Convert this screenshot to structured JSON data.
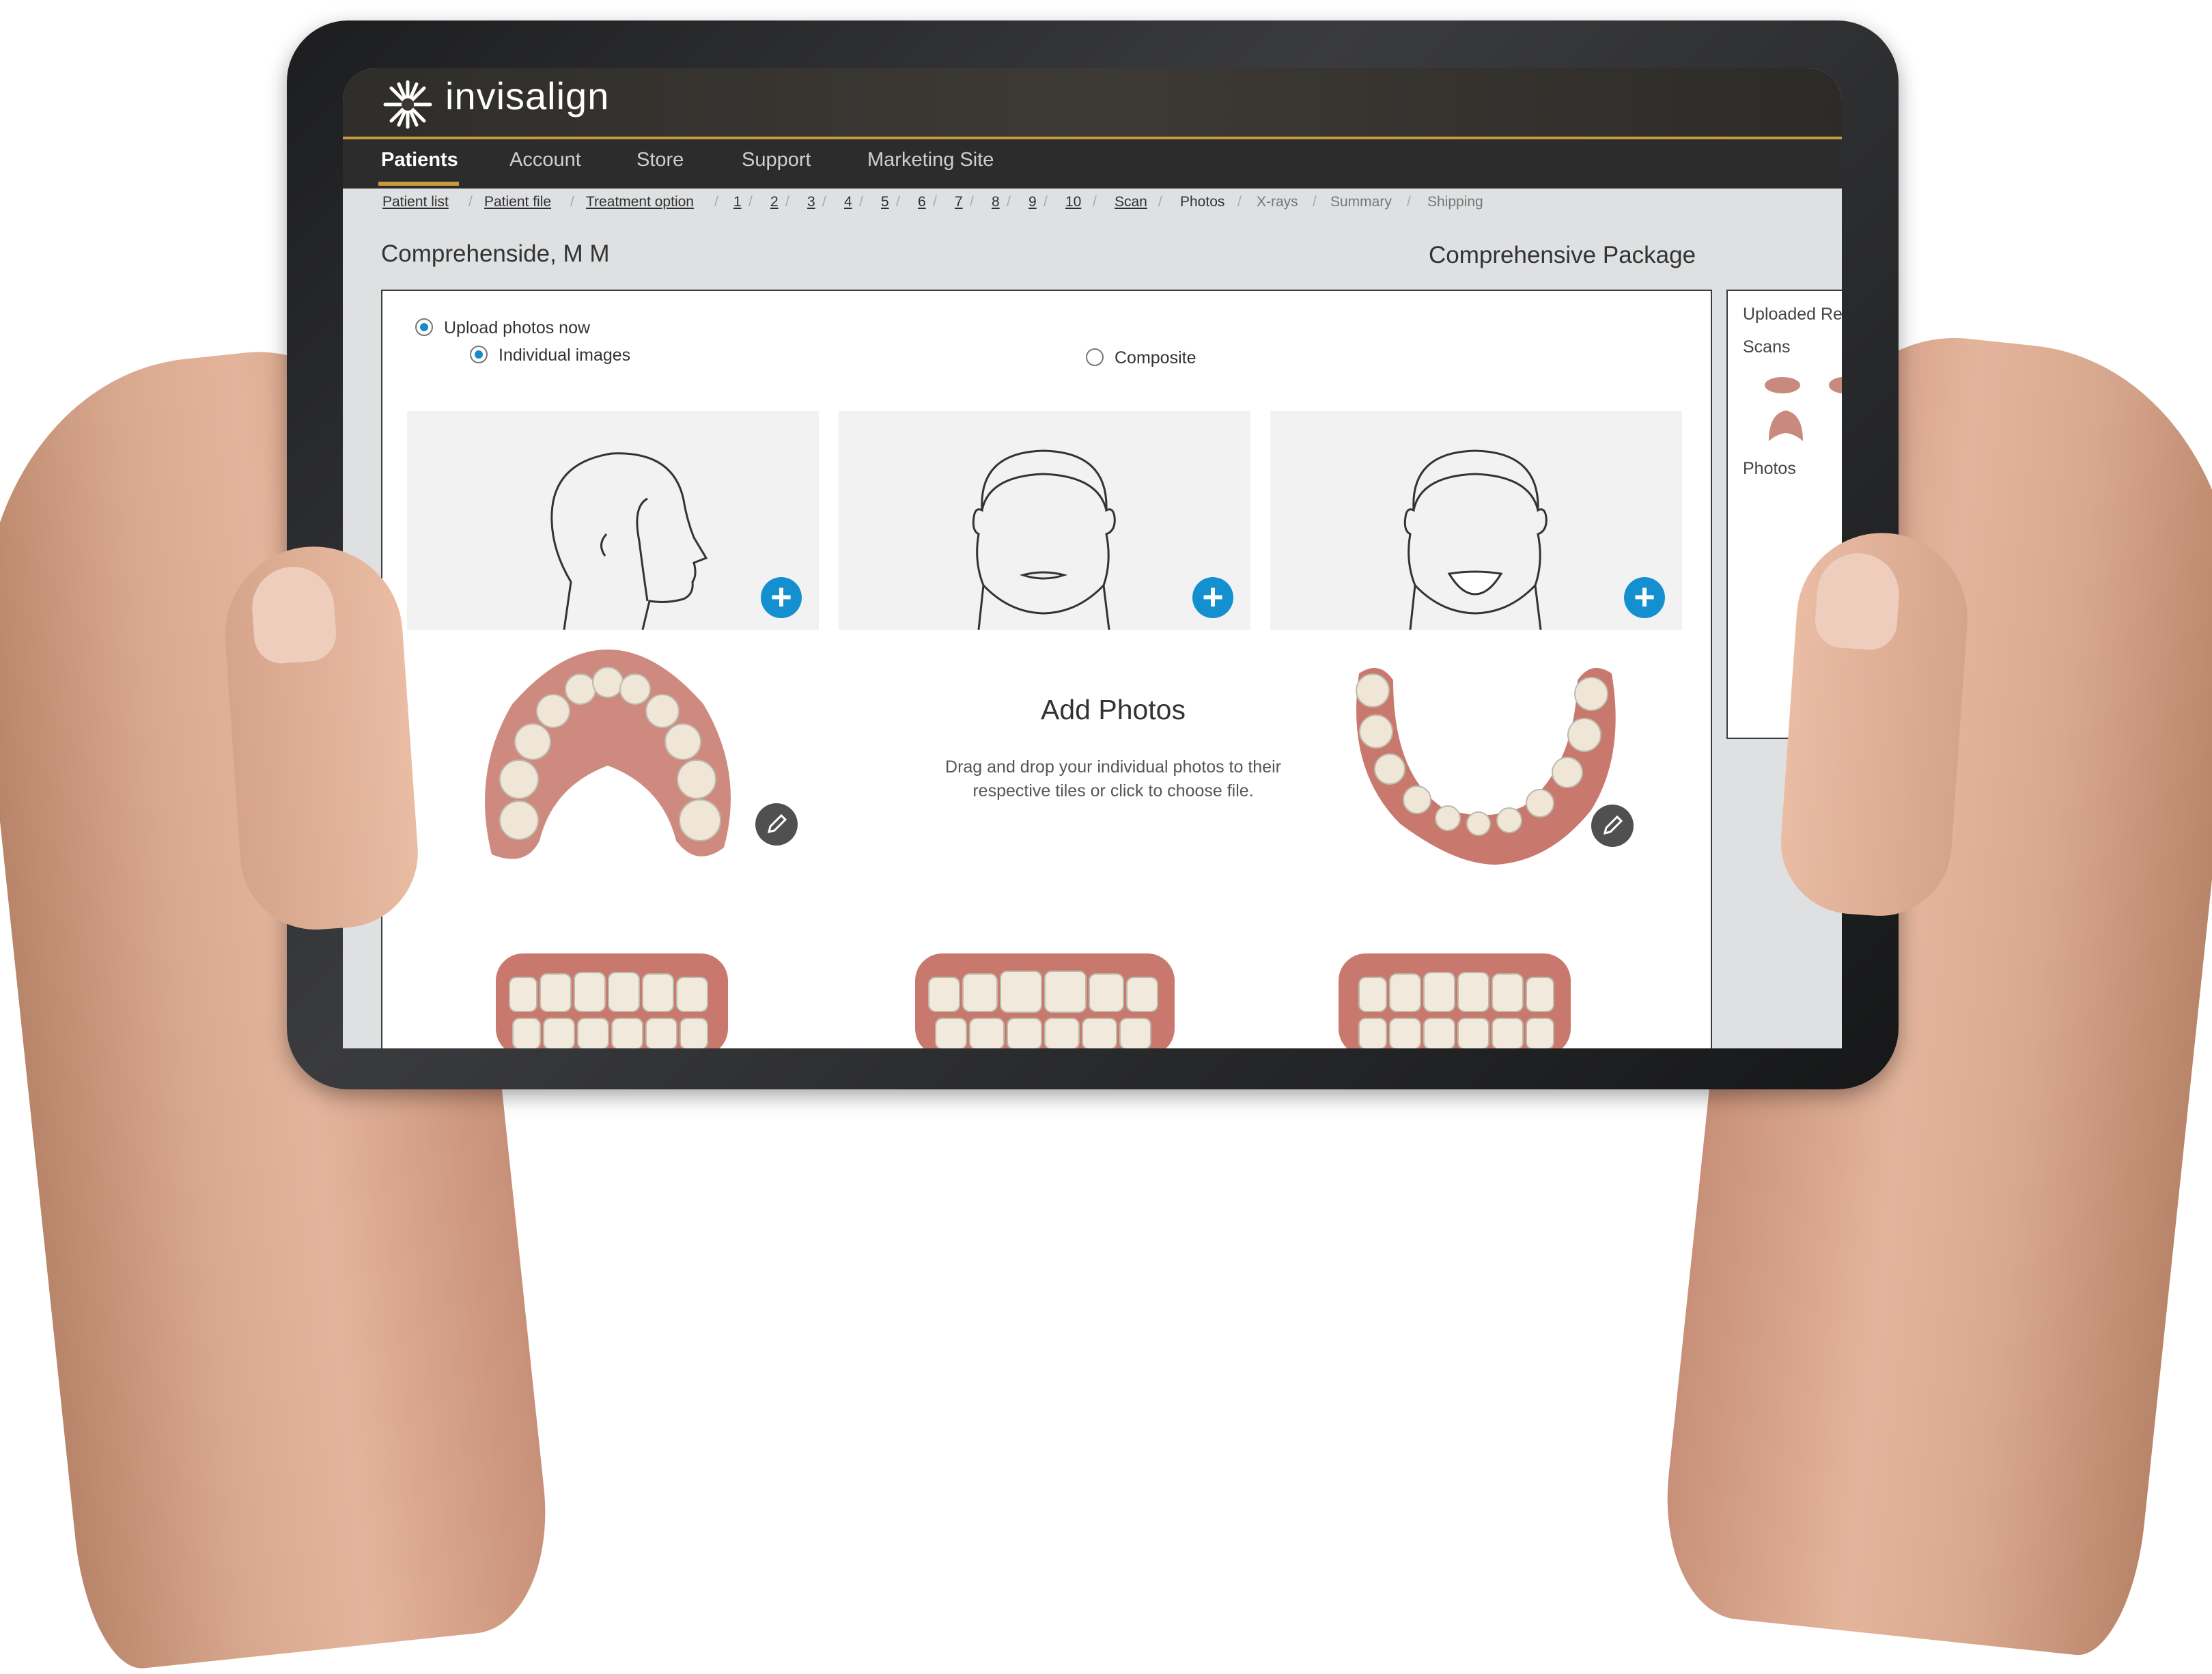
{
  "app": {
    "logo_text": "invisalign",
    "brand_accent": "#c99a3d",
    "upload_accent": "#1490d0"
  },
  "nav": {
    "items": [
      {
        "label": "Patients",
        "active": true
      },
      {
        "label": "Account"
      },
      {
        "label": "Store"
      },
      {
        "label": "Support"
      },
      {
        "label": "Marketing Site"
      }
    ]
  },
  "breadcrumb": {
    "items": [
      {
        "label": "Patient list"
      },
      {
        "label": "Patient file"
      },
      {
        "label": "Treatment option"
      },
      {
        "label": "1"
      },
      {
        "label": "2"
      },
      {
        "label": "3"
      },
      {
        "label": "4"
      },
      {
        "label": "5"
      },
      {
        "label": "6"
      },
      {
        "label": "7"
      },
      {
        "label": "8"
      },
      {
        "label": "9"
      },
      {
        "label": "10"
      },
      {
        "label": "Scan"
      },
      {
        "label": "Photos"
      },
      {
        "label": "X-rays"
      },
      {
        "label": "Summary"
      },
      {
        "label": "Shipping"
      }
    ],
    "separator": "/"
  },
  "patient": {
    "name": "Comprehenside, M M",
    "package": "Comprehensive Package"
  },
  "upload": {
    "upload_now_label": "Upload photos now",
    "individual_label": "Individual images",
    "composite_label": "Composite",
    "add_title": "Add Photos",
    "add_description": "Drag and drop your individual photos to their respective tiles or click to choose file.",
    "plus_glyph": "+",
    "edit_glyph": "✎"
  },
  "side": {
    "title": "Uploaded Re",
    "scans_label": "Scans",
    "photos_label": "Photos"
  }
}
